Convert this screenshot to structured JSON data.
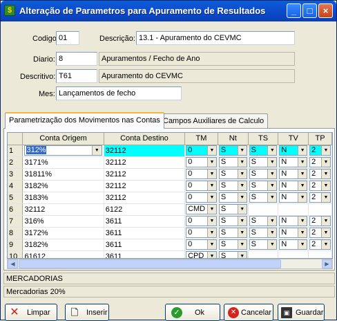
{
  "window": {
    "title": "Alteração de Parametros para Apuramento de Resultados",
    "icon": "money-icon"
  },
  "form": {
    "codigo_label": "Codigo",
    "codigo_value": "01",
    "descricao_label": "Descrição:",
    "descricao_value": "13.1 - Apuramento do CEVMC",
    "diario_label": "Diario:",
    "diario_value": "8",
    "diario_desc": "Apuramentos / Fecho de Ano",
    "descritivo_label": "Descritivo:",
    "descritivo_value": "T61",
    "descritivo_desc": "Apuramento do CEVMC",
    "mes_label": "Mes:",
    "mes_value": "Lançamentos de fecho"
  },
  "tabs": [
    {
      "label": "Parametrização dos Movimentos nas Contas",
      "active": true
    },
    {
      "label": "Campos Auxiliares de Calculo",
      "active": false
    }
  ],
  "grid": {
    "columns": [
      "Conta Origem",
      "Conta Destino",
      "TM",
      "Nt",
      "TS",
      "TV",
      "TP"
    ],
    "rows": [
      {
        "n": "1",
        "origem": "312%",
        "destino": "32112",
        "tm": "0",
        "nt": "S",
        "ts": "S",
        "tv": "N",
        "tp": "2"
      },
      {
        "n": "2",
        "origem": "3171%",
        "destino": "32112",
        "tm": "0",
        "nt": "S",
        "ts": "S",
        "tv": "N",
        "tp": "2"
      },
      {
        "n": "3",
        "origem": "31811%",
        "destino": "32112",
        "tm": "0",
        "nt": "S",
        "ts": "S",
        "tv": "N",
        "tp": "2"
      },
      {
        "n": "4",
        "origem": "3182%",
        "destino": "32112",
        "tm": "0",
        "nt": "S",
        "ts": "S",
        "tv": "N",
        "tp": "2"
      },
      {
        "n": "5",
        "origem": "3183%",
        "destino": "32112",
        "tm": "0",
        "nt": "S",
        "ts": "S",
        "tv": "N",
        "tp": "2"
      },
      {
        "n": "6",
        "origem": "32112",
        "destino": "6122",
        "tm": "CMD",
        "nt": "S",
        "ts": "",
        "tv": "",
        "tp": ""
      },
      {
        "n": "7",
        "origem": "316%",
        "destino": "3611",
        "tm": "0",
        "nt": "S",
        "ts": "S",
        "tv": "N",
        "tp": "2"
      },
      {
        "n": "8",
        "origem": "3172%",
        "destino": "3611",
        "tm": "0",
        "nt": "S",
        "ts": "S",
        "tv": "N",
        "tp": "2"
      },
      {
        "n": "9",
        "origem": "3182%",
        "destino": "3611",
        "tm": "0",
        "nt": "S",
        "ts": "S",
        "tv": "N",
        "tp": "2"
      },
      {
        "n": "10",
        "origem": "61612",
        "destino": "3611",
        "tm": "CPD",
        "nt": "S",
        "ts": "",
        "tv": "",
        "tp": ""
      }
    ]
  },
  "info": {
    "line1": "MERCADORIAS",
    "line2": "Mercadorias 20%"
  },
  "buttons": {
    "limpar": "Limpar",
    "inserir": "Inserir",
    "ok": "Ok",
    "cancelar": "Cancelar",
    "guardar": "Guardar"
  }
}
